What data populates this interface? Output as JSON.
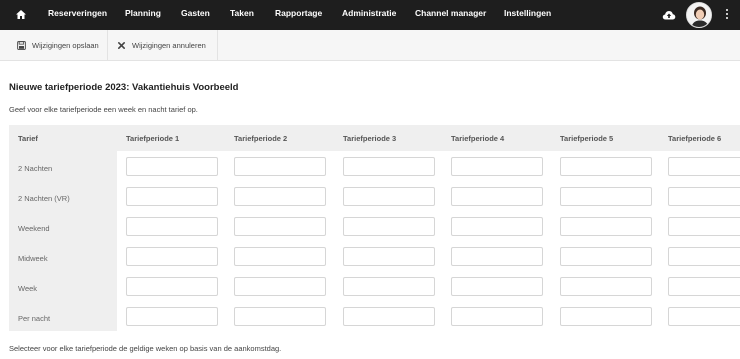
{
  "nav": {
    "home_icon": "home-icon",
    "items": [
      {
        "label": "Reserveringen"
      },
      {
        "label": "Planning"
      },
      {
        "label": "Gasten"
      },
      {
        "label": "Taken"
      },
      {
        "label": "Rapportage"
      },
      {
        "label": "Administratie"
      },
      {
        "label": "Channel manager"
      },
      {
        "label": "Instellingen"
      }
    ],
    "cloud_icon": "cloud-upload-icon",
    "menu_icon": "kebab-menu-icon"
  },
  "toolbar": {
    "save_label": "Wijzigingen opslaan",
    "save_icon": "floppy-disk-icon",
    "cancel_label": "Wijzigingen annuleren",
    "cancel_icon": "x-icon"
  },
  "main": {
    "title": "Nieuwe tariefperiode 2023: Vakantiehuis Voorbeeld",
    "intro": "Geef voor elke tariefperiode een week en nacht tarief op.",
    "footer": "Selecteer voor elke tariefperiode de geldige weken op basis van de aankomstdag."
  },
  "table": {
    "row_header": "Tarief",
    "columns": [
      "Tariefperiode 1",
      "Tariefperiode 2",
      "Tariefperiode 3",
      "Tariefperiode 4",
      "Tariefperiode 5",
      "Tariefperiode 6"
    ],
    "rows": [
      "2 Nachten",
      "2 Nachten (VR)",
      "Weekend",
      "Midweek",
      "Week",
      "Per nacht"
    ]
  },
  "colors": {
    "topbar": "#1e1e1e",
    "toolbar": "#f6f6f6",
    "table_header": "#efefef"
  }
}
